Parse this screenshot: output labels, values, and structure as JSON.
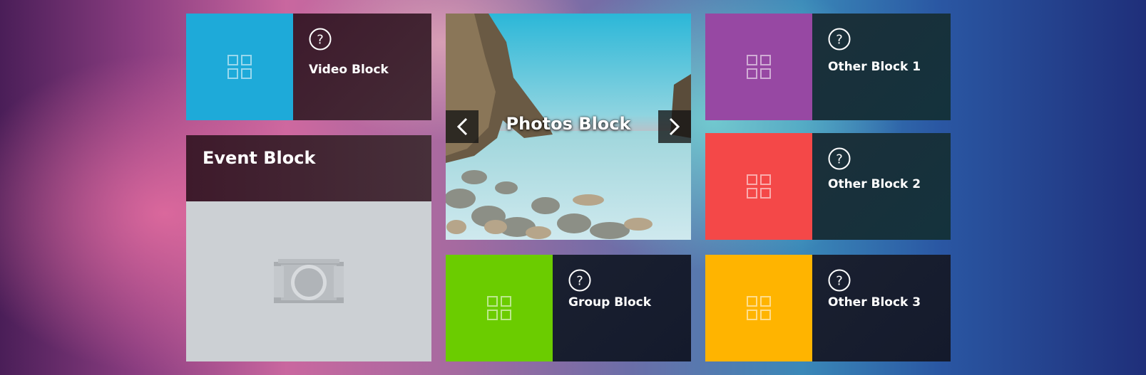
{
  "tiles": {
    "video": {
      "label": "Video Block",
      "color": "#1eaad9",
      "icon": "grid-icon"
    },
    "event": {
      "title": "Event Block",
      "placeholder_icon": "camera-icon"
    },
    "photos": {
      "title": "Photos Block",
      "prev_icon": "chevron-left-icon",
      "next_icon": "chevron-right-icon"
    },
    "group": {
      "label": "Group Block",
      "color": "#6bcc00",
      "icon": "grid-icon"
    },
    "other1": {
      "label": "Other Block 1",
      "color": "#9748a3",
      "icon": "grid-icon"
    },
    "other2": {
      "label": "Other Block 2",
      "color": "#f44848",
      "icon": "grid-icon"
    },
    "other3": {
      "label": "Other Block 3",
      "color": "#ffb400",
      "icon": "grid-icon"
    }
  },
  "help_icon": "help-question-icon"
}
